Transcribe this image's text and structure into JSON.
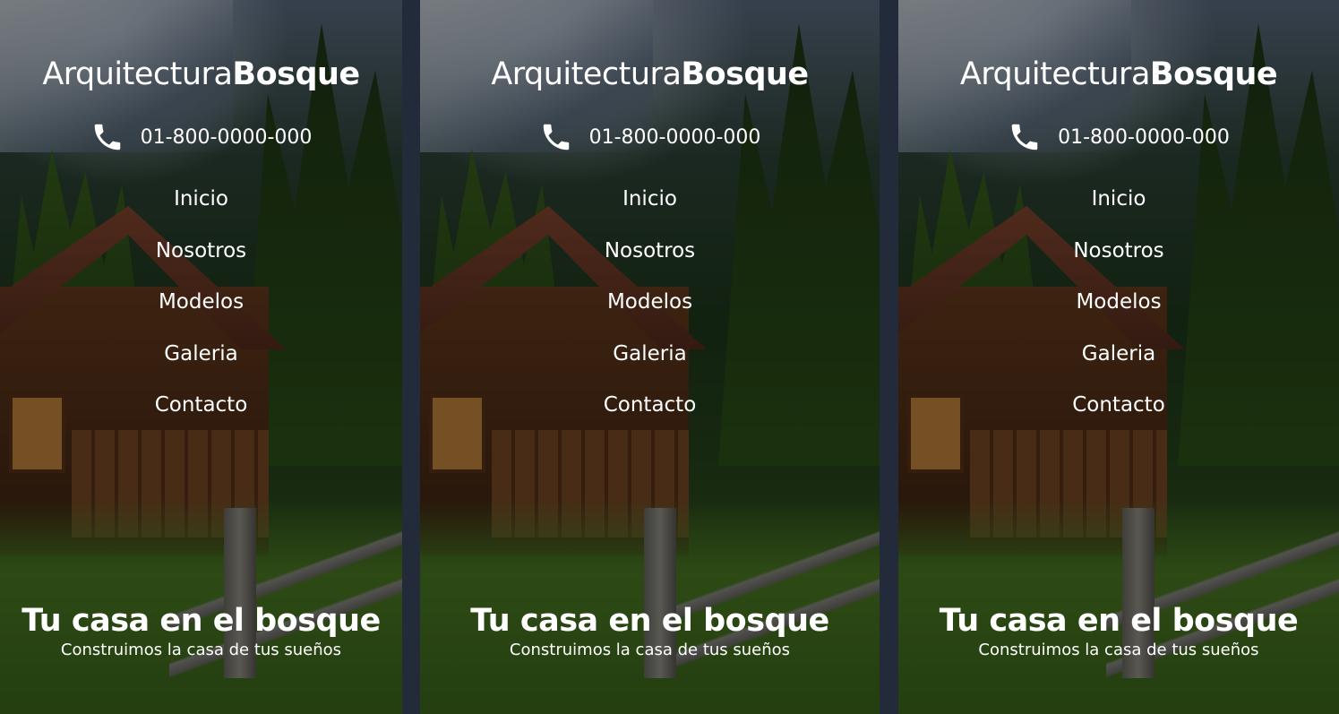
{
  "panels": [
    {
      "brand": {
        "light": "Arquitectura",
        "bold": "Bosque"
      },
      "phone": {
        "icon": "phone-icon",
        "number": "01-800-0000-000"
      },
      "nav": [
        "Inicio",
        "Nosotros",
        "Modelos",
        "Galeria",
        "Contacto"
      ],
      "hero": {
        "title": "Tu casa en el bosque",
        "subtitle": "Construimos la casa de tus sueños"
      }
    },
    {
      "brand": {
        "light": "Arquitectura",
        "bold": "Bosque"
      },
      "phone": {
        "icon": "phone-icon",
        "number": "01-800-0000-000"
      },
      "nav": [
        "Inicio",
        "Nosotros",
        "Modelos",
        "Galeria",
        "Contacto"
      ],
      "hero": {
        "title": "Tu casa en el bosque",
        "subtitle": "Construimos la casa de tus sueños"
      }
    },
    {
      "brand": {
        "light": "Arquitectura",
        "bold": "Bosque"
      },
      "phone": {
        "icon": "phone-icon",
        "number": "01-800-0000-000"
      },
      "nav": [
        "Inicio",
        "Nosotros",
        "Modelos",
        "Galeria",
        "Contacto"
      ],
      "hero": {
        "title": "Tu casa en el bosque",
        "subtitle": "Construimos la casa de tus sueños"
      }
    }
  ],
  "colors": {
    "text": "#ffffff",
    "gutter": "#232a3a",
    "overlay": "rgba(0,0,0,0.42)"
  }
}
